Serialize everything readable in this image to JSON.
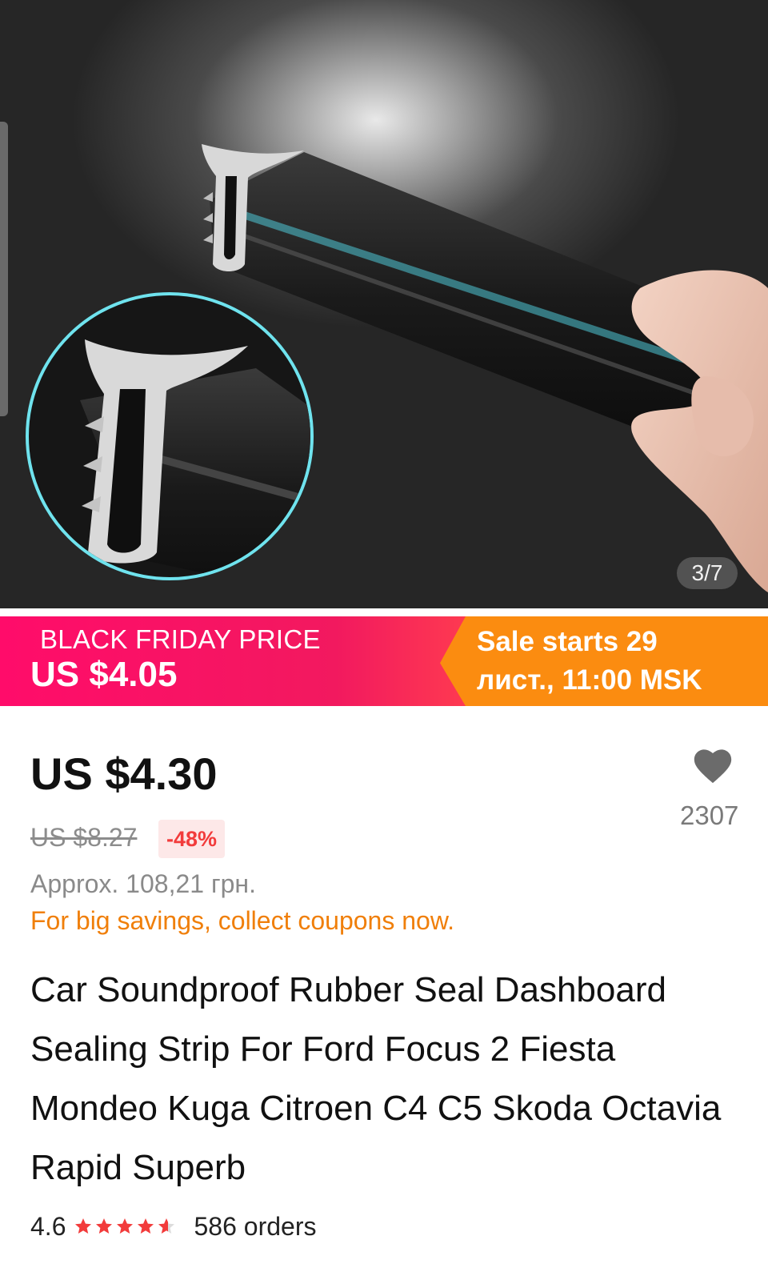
{
  "gallery": {
    "counter": "3/7",
    "image_icon": "product-photo-icon"
  },
  "promo": {
    "label": "BLACK FRIDAY PRICE",
    "price": "US $4.05",
    "sale_line1": "Sale starts 29",
    "sale_line2": "лист., 11:00 MSK",
    "colors": {
      "pink": "#f2195f",
      "orange": "#fb8c10"
    }
  },
  "price": {
    "current": "US $4.30",
    "original": "US $8.27",
    "discount": "-48%",
    "approx": "Approx. 108,21 грн.",
    "coupons": "For big savings, collect coupons now."
  },
  "wishlist": {
    "icon": "heart-icon",
    "count": "2307"
  },
  "product": {
    "title": "Car Soundproof Rubber Seal Dashboard Sealing Strip For Ford Focus 2 Fiesta Mondeo Kuga Citroen C4 C5 Skoda Octavia Rapid Superb"
  },
  "rating": {
    "score": "4.6",
    "stars": 4.6,
    "star_icon": "star-icon",
    "star_color": "#f23b3b",
    "orders": "586 orders"
  }
}
